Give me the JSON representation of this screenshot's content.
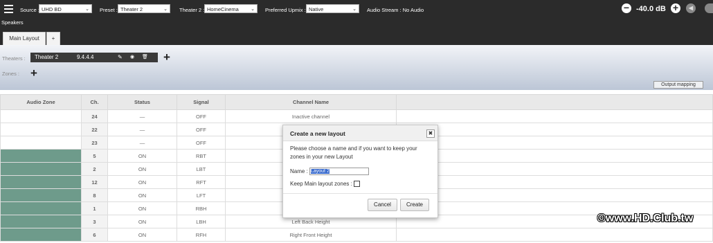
{
  "topbar": {
    "source_label": "Source :",
    "source_value": "UHD BD",
    "preset_label": "Preset :",
    "preset_value": "Theater 2",
    "theater_label": "Theater 2 :",
    "theater_value": "HomeCinema",
    "upmix_label": "Preferred Upmix :",
    "upmix_value": "Native",
    "audio_stream": "Audio Stream : No Audio",
    "volume": "-40.0 dB",
    "volume_down_symbol": "−",
    "volume_up_symbol": "+",
    "mute_symbol": "◀",
    "speakers_label": "Speakers"
  },
  "tabs": {
    "main_layout": "Main Layout",
    "add": "+"
  },
  "layout_panel": {
    "theaters_label": "Theaters :",
    "theater_name": "Theater 2",
    "theater_format": "9.4.4.4",
    "edit_icon": "✎",
    "view_icon": "◉",
    "delete_icon": "🗑",
    "add_symbol": "+",
    "zones_label": "Zones :",
    "output_mapping": "Output mapping"
  },
  "table": {
    "headers": [
      "Audio Zone",
      "Ch.",
      "Status",
      "Signal",
      "Channel Name"
    ],
    "rows": [
      {
        "ch": "24",
        "status": "—",
        "signal": "OFF",
        "name": "Inactive channel",
        "zone_active": false
      },
      {
        "ch": "22",
        "status": "—",
        "signal": "OFF",
        "name": "",
        "zone_active": false
      },
      {
        "ch": "23",
        "status": "—",
        "signal": "OFF",
        "name": "",
        "zone_active": false
      },
      {
        "ch": "5",
        "status": "ON",
        "signal": "RBT",
        "name": "",
        "zone_active": true
      },
      {
        "ch": "2",
        "status": "ON",
        "signal": "LBT",
        "name": "",
        "zone_active": true
      },
      {
        "ch": "12",
        "status": "ON",
        "signal": "RFT",
        "name": "",
        "zone_active": true
      },
      {
        "ch": "8",
        "status": "ON",
        "signal": "LFT",
        "name": "",
        "zone_active": true
      },
      {
        "ch": "1",
        "status": "ON",
        "signal": "RBH",
        "name": "",
        "zone_active": true
      },
      {
        "ch": "3",
        "status": "ON",
        "signal": "LBH",
        "name": "Left Back Height",
        "zone_active": true
      },
      {
        "ch": "6",
        "status": "ON",
        "signal": "RFH",
        "name": "Right Front Height",
        "zone_active": true
      }
    ]
  },
  "modal": {
    "title": "Create a new layout",
    "close_symbol": "✖",
    "description": "Please choose a name and if you want to keep your zones in your new Layout",
    "name_label": "Name :",
    "name_value": "Layout 2",
    "keep_label": "Keep Main layout zones :",
    "cancel": "Cancel",
    "create": "Create"
  },
  "watermark": "©www.HD.Club.tw",
  "colors": {
    "topbar": "#2b2b2b",
    "zone_active": "#6e9b8b"
  }
}
